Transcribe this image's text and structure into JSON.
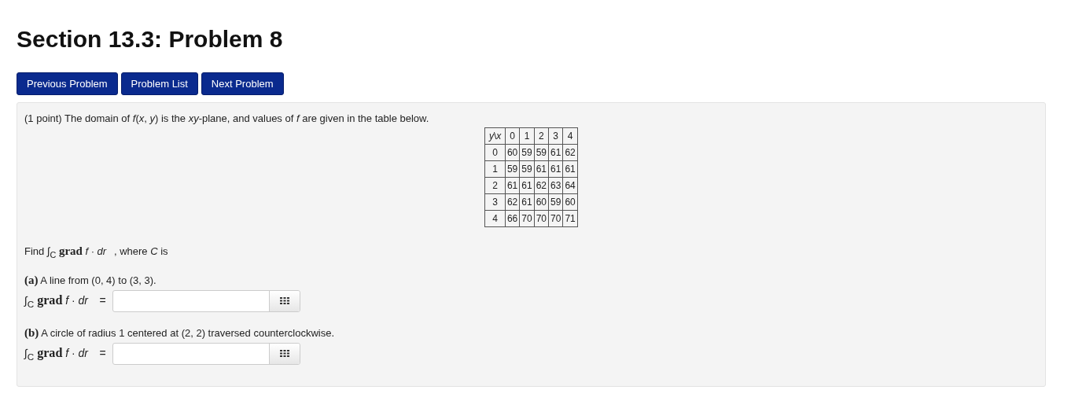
{
  "title": "Section 13.3: Problem 8",
  "nav_buttons": [
    "Previous Problem",
    "Problem List",
    "Next Problem"
  ],
  "intro": "(1 point) The domain of *f*(*x*, *y*) is the *xy*-plane, and values of *f* are given in the table below.",
  "table": {
    "corner": "*y*\\*x*",
    "columns": [
      "0",
      "1",
      "2",
      "3",
      "4"
    ],
    "rows": [
      {
        "label": "0",
        "values": [
          "60",
          "59",
          "59",
          "61",
          "62"
        ]
      },
      {
        "label": "1",
        "values": [
          "59",
          "59",
          "61",
          "61",
          "61"
        ]
      },
      {
        "label": "2",
        "values": [
          "61",
          "61",
          "62",
          "63",
          "64"
        ]
      },
      {
        "label": "3",
        "values": [
          "62",
          "61",
          "60",
          "59",
          "60"
        ]
      },
      {
        "label": "4",
        "values": [
          "66",
          "70",
          "70",
          "70",
          "71"
        ]
      }
    ]
  },
  "question": "Find ∫$_{C}$ **grad** *f* · *dr⃗*, where *C* is",
  "parts": [
    {
      "text": "**(a)** A line from (0, 4) to (3, 3).",
      "answer_label": "∫$_{C}$ **grad** *f* · *dr⃗* ="
    },
    {
      "text": "**(b)** A circle of radius 1 centered at (2, 2) traversed counterclockwise.",
      "answer_label": "∫$_{C}$ **grad** *f* · *dr⃗* ="
    }
  ]
}
